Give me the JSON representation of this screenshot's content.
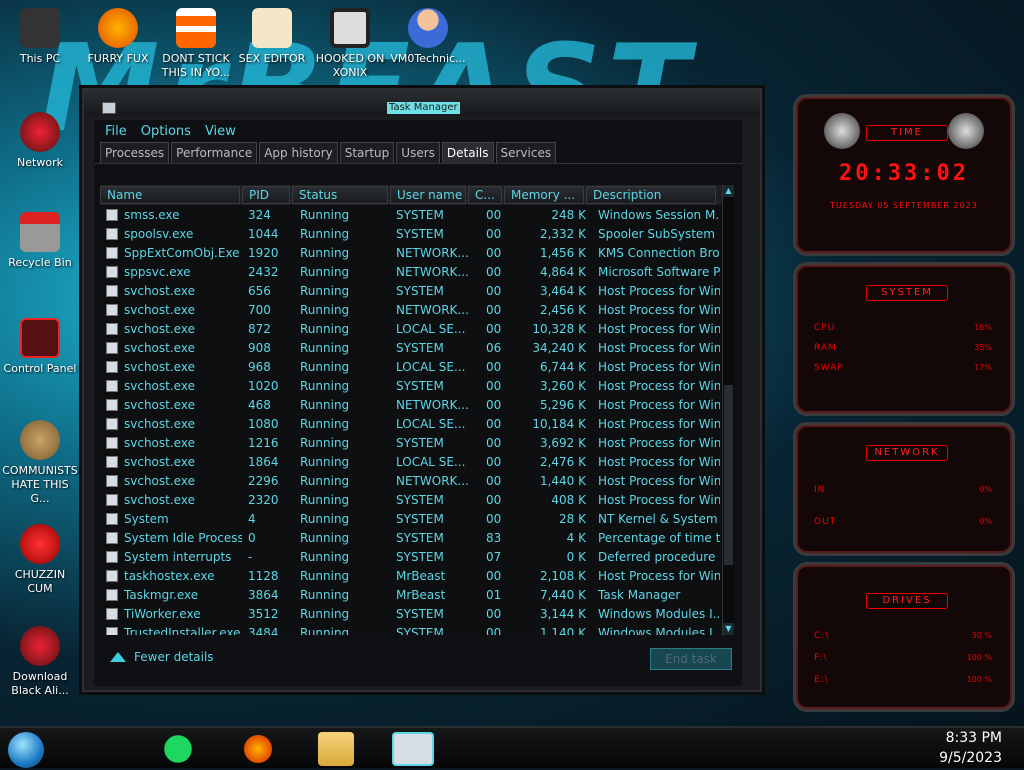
{
  "desktop": {
    "icons": [
      {
        "label": "This PC"
      },
      {
        "label": "FURRY FUX"
      },
      {
        "label": "DONT STICK THIS IN YO..."
      },
      {
        "label": "SEX EDITOR"
      },
      {
        "label": "HOOKED ON XONIX"
      },
      {
        "label": "VM0Technic..."
      },
      {
        "label": "Network"
      },
      {
        "label": "Recycle Bin"
      },
      {
        "label": "Control Panel"
      },
      {
        "label": "COMMUNISTS HATE THIS G..."
      },
      {
        "label": "CHUZZIN CUM"
      },
      {
        "label": "Download Black Ali..."
      }
    ]
  },
  "task_manager": {
    "title": "Task Manager",
    "menu": [
      "File",
      "Options",
      "View"
    ],
    "tabs": [
      "Processes",
      "Performance",
      "App history",
      "Startup",
      "Users",
      "Details",
      "Services"
    ],
    "active_tab": "Details",
    "columns": [
      "Name",
      "PID",
      "Status",
      "User name",
      "C...",
      "Memory ...",
      "Description"
    ],
    "rows": [
      [
        "smss.exe",
        "324",
        "Running",
        "SYSTEM",
        "00",
        "248 K",
        "Windows Session M..."
      ],
      [
        "spoolsv.exe",
        "1044",
        "Running",
        "SYSTEM",
        "00",
        "2,332 K",
        "Spooler SubSystem ..."
      ],
      [
        "SppExtComObj.Exe",
        "1920",
        "Running",
        "NETWORK...",
        "00",
        "1,456 K",
        "KMS Connection Bro..."
      ],
      [
        "sppsvc.exe",
        "2432",
        "Running",
        "NETWORK...",
        "00",
        "4,864 K",
        "Microsoft Software P..."
      ],
      [
        "svchost.exe",
        "656",
        "Running",
        "SYSTEM",
        "00",
        "3,464 K",
        "Host Process for Win..."
      ],
      [
        "svchost.exe",
        "700",
        "Running",
        "NETWORK...",
        "00",
        "2,456 K",
        "Host Process for Win..."
      ],
      [
        "svchost.exe",
        "872",
        "Running",
        "LOCAL SE...",
        "00",
        "10,328 K",
        "Host Process for Win..."
      ],
      [
        "svchost.exe",
        "908",
        "Running",
        "SYSTEM",
        "06",
        "34,240 K",
        "Host Process for Win..."
      ],
      [
        "svchost.exe",
        "968",
        "Running",
        "LOCAL SE...",
        "00",
        "6,744 K",
        "Host Process for Win..."
      ],
      [
        "svchost.exe",
        "1020",
        "Running",
        "SYSTEM",
        "00",
        "3,260 K",
        "Host Process for Win..."
      ],
      [
        "svchost.exe",
        "468",
        "Running",
        "NETWORK...",
        "00",
        "5,296 K",
        "Host Process for Win..."
      ],
      [
        "svchost.exe",
        "1080",
        "Running",
        "LOCAL SE...",
        "00",
        "10,184 K",
        "Host Process for Win..."
      ],
      [
        "svchost.exe",
        "1216",
        "Running",
        "SYSTEM",
        "00",
        "3,692 K",
        "Host Process for Win..."
      ],
      [
        "svchost.exe",
        "1864",
        "Running",
        "LOCAL SE...",
        "00",
        "2,476 K",
        "Host Process for Win..."
      ],
      [
        "svchost.exe",
        "2296",
        "Running",
        "NETWORK...",
        "00",
        "1,440 K",
        "Host Process for Win..."
      ],
      [
        "svchost.exe",
        "2320",
        "Running",
        "SYSTEM",
        "00",
        "408 K",
        "Host Process for Win..."
      ],
      [
        "System",
        "4",
        "Running",
        "SYSTEM",
        "00",
        "28 K",
        "NT Kernel & System"
      ],
      [
        "System Idle Process",
        "0",
        "Running",
        "SYSTEM",
        "83",
        "4 K",
        "Percentage of time t..."
      ],
      [
        "System interrupts",
        "-",
        "Running",
        "SYSTEM",
        "07",
        "0 K",
        "Deferred procedure ..."
      ],
      [
        "taskhostex.exe",
        "1128",
        "Running",
        "MrBeast",
        "00",
        "2,108 K",
        "Host Process for Win..."
      ],
      [
        "Taskmgr.exe",
        "3864",
        "Running",
        "MrBeast",
        "01",
        "7,440 K",
        "Task Manager"
      ],
      [
        "TiWorker.exe",
        "3512",
        "Running",
        "SYSTEM",
        "00",
        "3,144 K",
        "Windows Modules I..."
      ],
      [
        "TrustedInstaller.exe",
        "3484",
        "Running",
        "SYSTEM",
        "00",
        "1,140 K",
        "Windows Modules I..."
      ]
    ],
    "fewer_details": "Fewer details",
    "end_task": "End task"
  },
  "widgets": {
    "time": {
      "title": "TIME",
      "clock": "20:33:02",
      "date": "TUESDAY 05 SEPTEMBER 2023"
    },
    "system": {
      "title": "SYSTEM",
      "rows": [
        {
          "label": "CPU",
          "value": "16%"
        },
        {
          "label": "RAM",
          "value": "35%"
        },
        {
          "label": "SWAP",
          "value": "17%"
        }
      ]
    },
    "network": {
      "title": "NETWORK",
      "rows": [
        {
          "label": "IN",
          "value": "0%"
        },
        {
          "label": "OUT",
          "value": "0%"
        }
      ]
    },
    "drives": {
      "title": "DRIVES",
      "rows": [
        {
          "label": "C:\\",
          "value": "30 %"
        },
        {
          "label": "F:\\",
          "value": "100 %"
        },
        {
          "label": "E:\\",
          "value": "100 %"
        }
      ]
    }
  },
  "taskbar": {
    "time": "8:33 PM",
    "date": "9/5/2023"
  },
  "colors": {
    "accent": "#5ed6e6",
    "widget_red": "#ee1111"
  }
}
